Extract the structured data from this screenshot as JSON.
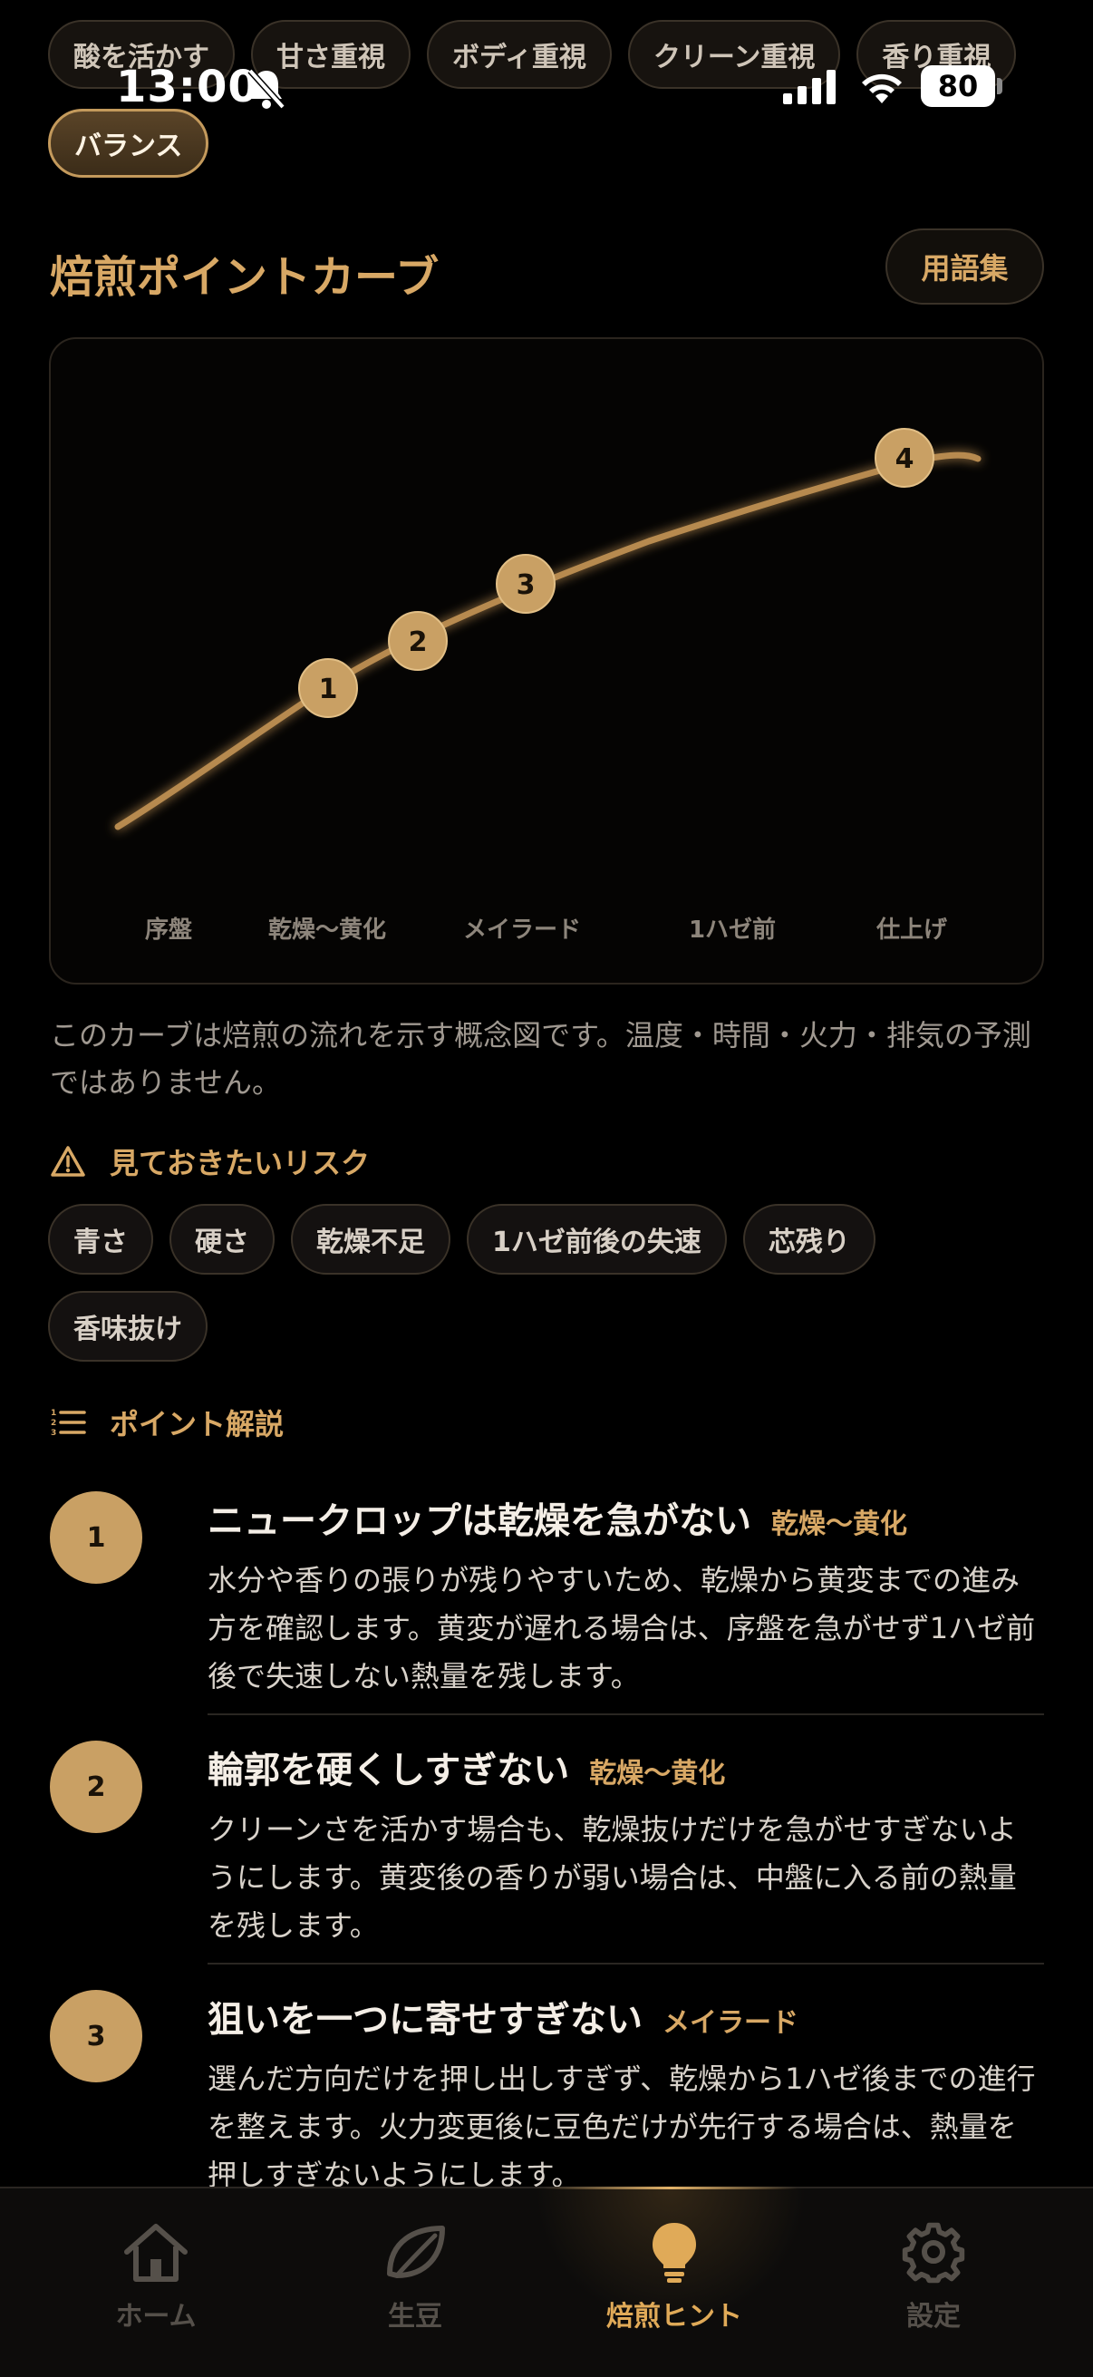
{
  "status_bar": {
    "time": "13:00",
    "battery": "80"
  },
  "filters": {
    "chips": [
      "酸を活かす",
      "甘さ重視",
      "ボディ重視",
      "クリーン重視",
      "香り重視"
    ],
    "selected": "バランス"
  },
  "curve_section": {
    "title": "焙煎ポイントカーブ",
    "glossary_label": "用語集",
    "caption": "このカーブは焙煎の流れを示す概念図です。温度・時間・火力・排気の予測ではありません。"
  },
  "chart_data": {
    "type": "line",
    "title": "",
    "x_labels": [
      "序盤",
      "乾燥〜黄化",
      "メイラード",
      "1ハゼ前",
      "仕上げ"
    ],
    "markers": [
      "1",
      "2",
      "3",
      "4"
    ],
    "colors": {
      "line": "#b78a4f",
      "marker": "#c9a064"
    }
  },
  "risks": {
    "heading": "見ておきたいリスク",
    "chips": [
      "青さ",
      "硬さ",
      "乾燥不足",
      "1ハゼ前後の失速",
      "芯残り",
      "香味抜け"
    ]
  },
  "points": {
    "heading": "ポイント解説",
    "items": [
      {
        "number": "1",
        "title": "ニュークロップは乾燥を急がない",
        "tag": "乾燥〜黄化",
        "text": "水分や香りの張りが残りやすいため、乾燥から黄変までの進み方を確認します。黄変が遅れる場合は、序盤を急がせず1ハゼ前後で失速しない熱量を残します。"
      },
      {
        "number": "2",
        "title": "輪郭を硬くしすぎない",
        "tag": "乾燥〜黄化",
        "text": "クリーンさを活かす場合も、乾燥抜けだけを急がせすぎないようにします。黄変後の香りが弱い場合は、中盤に入る前の熱量を残します。"
      },
      {
        "number": "3",
        "title": "狙いを一つに寄せすぎない",
        "tag": "メイラード",
        "text": "選んだ方向だけを押し出しすぎず、乾燥から1ハゼ後までの進行を整えます。火力変更後に豆色だけが先行する場合は、熱量を押しすぎないようにします。"
      }
    ]
  },
  "tab_bar": {
    "active": "焙煎ヒント",
    "tabs": [
      {
        "label": "ホーム",
        "icon": "house-icon"
      },
      {
        "label": "生豆",
        "icon": "leaf-icon"
      },
      {
        "label": "焙煎ヒント",
        "icon": "lightbulb-icon"
      },
      {
        "label": "設定",
        "icon": "gear-icon"
      }
    ]
  }
}
